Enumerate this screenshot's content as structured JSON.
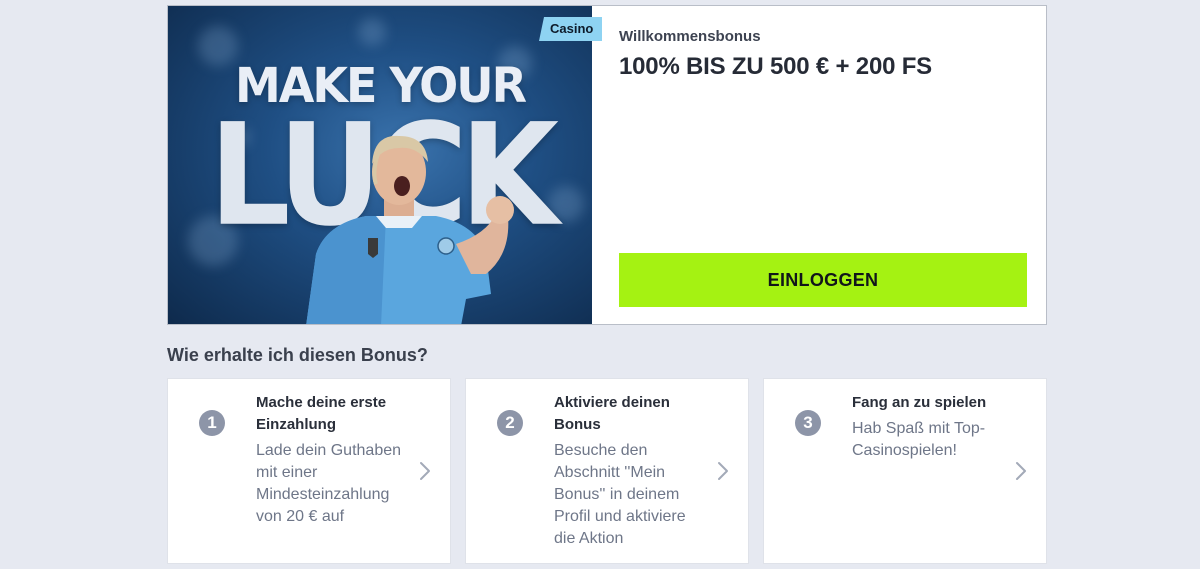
{
  "bonus": {
    "tag": "Casino",
    "hero_line1": "MAKE YOUR",
    "hero_line2": "LUCK",
    "label": "Willkommensbonus",
    "headline": "100% BIS ZU 500 € + 200 FS",
    "login_button": "EINLOGGEN",
    "accent_color": "#a5f212",
    "tag_color": "#8ed3f2"
  },
  "steps_heading": "Wie erhalte ich diesen Bonus?",
  "steps": [
    {
      "number": "1",
      "title": "Mache deine erste Einzahlung",
      "description": "Lade dein Guthaben mit einer Mindesteinzahlung von 20 € auf"
    },
    {
      "number": "2",
      "title": "Aktiviere deinen Bonus",
      "description": "Besuche den Abschnitt ''Mein Bonus'' in deinem Profil und aktiviere die Aktion"
    },
    {
      "number": "3",
      "title": "Fang an zu spielen",
      "description": "Hab Spaß mit Top-Casinospielen!"
    }
  ],
  "icons": {
    "chevron": "chevron-right-icon"
  }
}
